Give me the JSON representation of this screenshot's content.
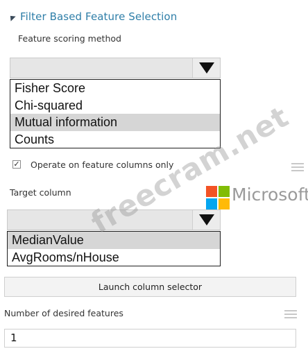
{
  "section": {
    "title": "Filter Based Feature Selection"
  },
  "scoring": {
    "label": "Feature scoring method",
    "options": [
      "Fisher Score",
      "Chi-squared",
      "Mutual information",
      "Counts"
    ],
    "selected_index": 2
  },
  "operate": {
    "label": "Operate on feature columns only",
    "checked": true
  },
  "target": {
    "label": "Target column",
    "options": [
      "MedianValue",
      "AvgRooms/nHouse"
    ],
    "selected_index": 0
  },
  "launch": {
    "label": "Launch column selector"
  },
  "features": {
    "label": "Number of desired features",
    "value": "1"
  },
  "logo": {
    "text": "Microsoft",
    "colors": [
      "#f35325",
      "#81bc06",
      "#05a6f0",
      "#ffba08"
    ]
  },
  "watermark": {
    "text": "freecram.net"
  },
  "icons": {
    "collapse": "collapse-triangle-icon",
    "dropdown": "chevron-down-icon",
    "menu": "hamburger-icon"
  }
}
